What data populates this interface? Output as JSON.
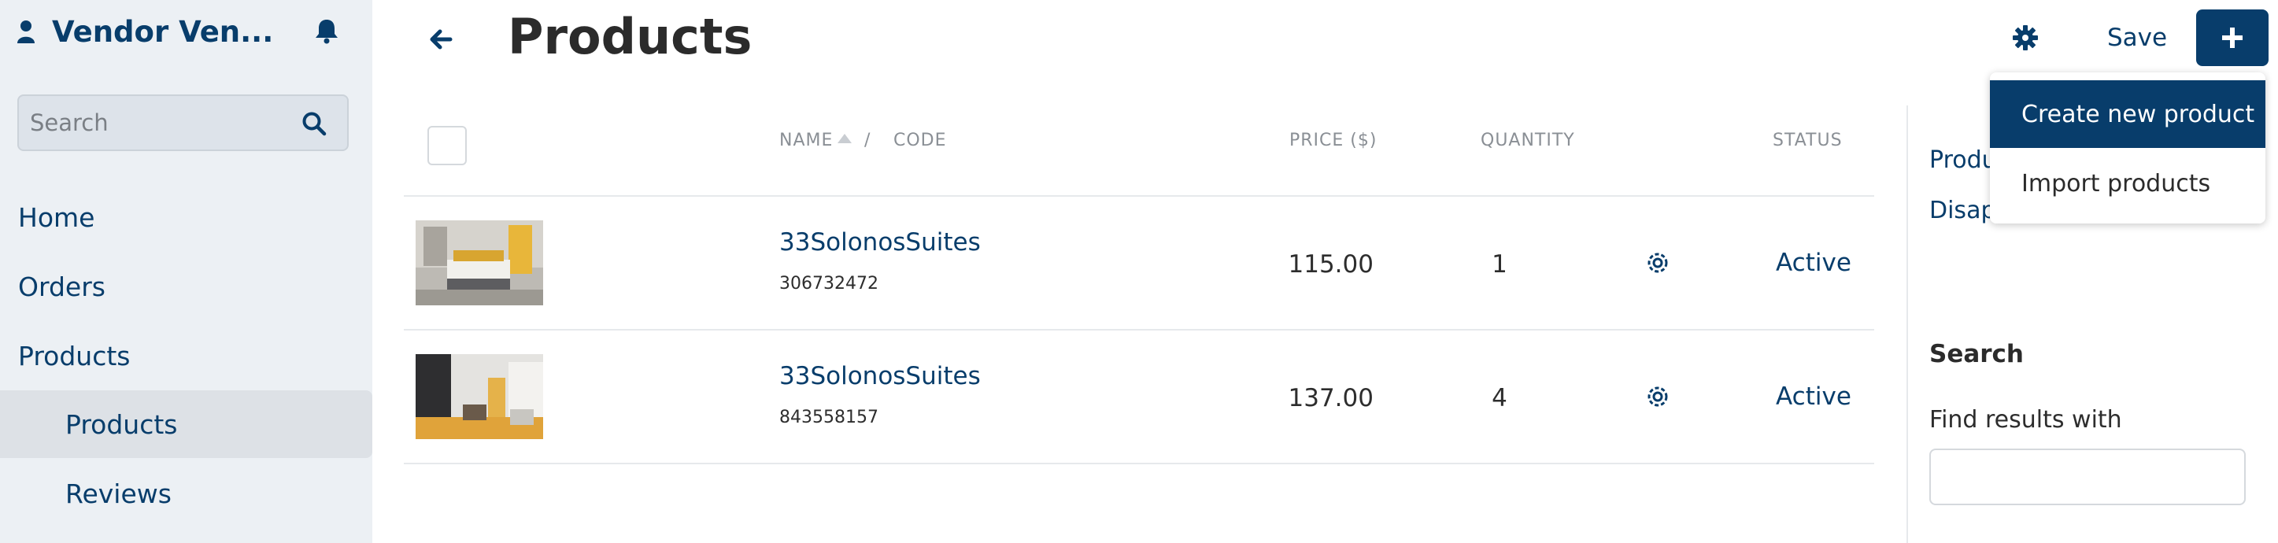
{
  "sidebar": {
    "vendor_name": "Vendor Ven...",
    "search_placeholder": "Search",
    "items": [
      {
        "label": "Home"
      },
      {
        "label": "Orders"
      },
      {
        "label": "Products"
      },
      {
        "label": "Products"
      },
      {
        "label": "Reviews"
      }
    ]
  },
  "header": {
    "title": "Products",
    "save_label": "Save"
  },
  "dropdown": {
    "items": [
      {
        "label": "Create new product"
      },
      {
        "label": "Import products"
      }
    ]
  },
  "table": {
    "columns": {
      "name": "NAME",
      "sep": "/",
      "code": "CODE",
      "price": "PRICE ($)",
      "quantity": "QUANTITY",
      "status": "STATUS"
    },
    "rows": [
      {
        "name": "33SolonosSuites",
        "code": "306732472",
        "price": "115.00",
        "quantity": "1",
        "status": "Active"
      },
      {
        "name": "33SolonosSuites",
        "code": "843558157",
        "price": "137.00",
        "quantity": "4",
        "status": "Active"
      }
    ]
  },
  "right_panel": {
    "links": [
      {
        "label": "Produ"
      },
      {
        "label": "Disap"
      }
    ],
    "search_heading": "Search",
    "find_label": "Find results with"
  },
  "colors": {
    "brand": "#083d6b",
    "sidebar_bg": "#ecf0f4",
    "active_bg": "#dde1e6"
  }
}
